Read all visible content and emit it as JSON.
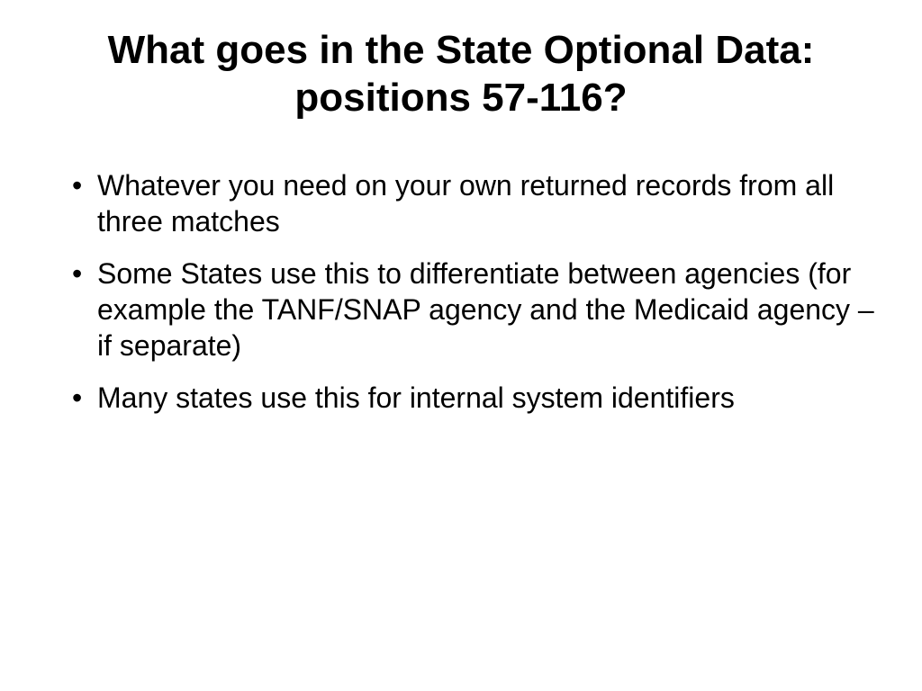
{
  "slide": {
    "title": "What goes in the State Optional Data: positions 57-116?",
    "bullets": [
      "Whatever you need on your own returned records from all three matches",
      "Some States use this to differentiate between agencies (for example the TANF/SNAP agency and the Medicaid agency – if separate)",
      "Many states use this for internal system identifiers"
    ]
  }
}
